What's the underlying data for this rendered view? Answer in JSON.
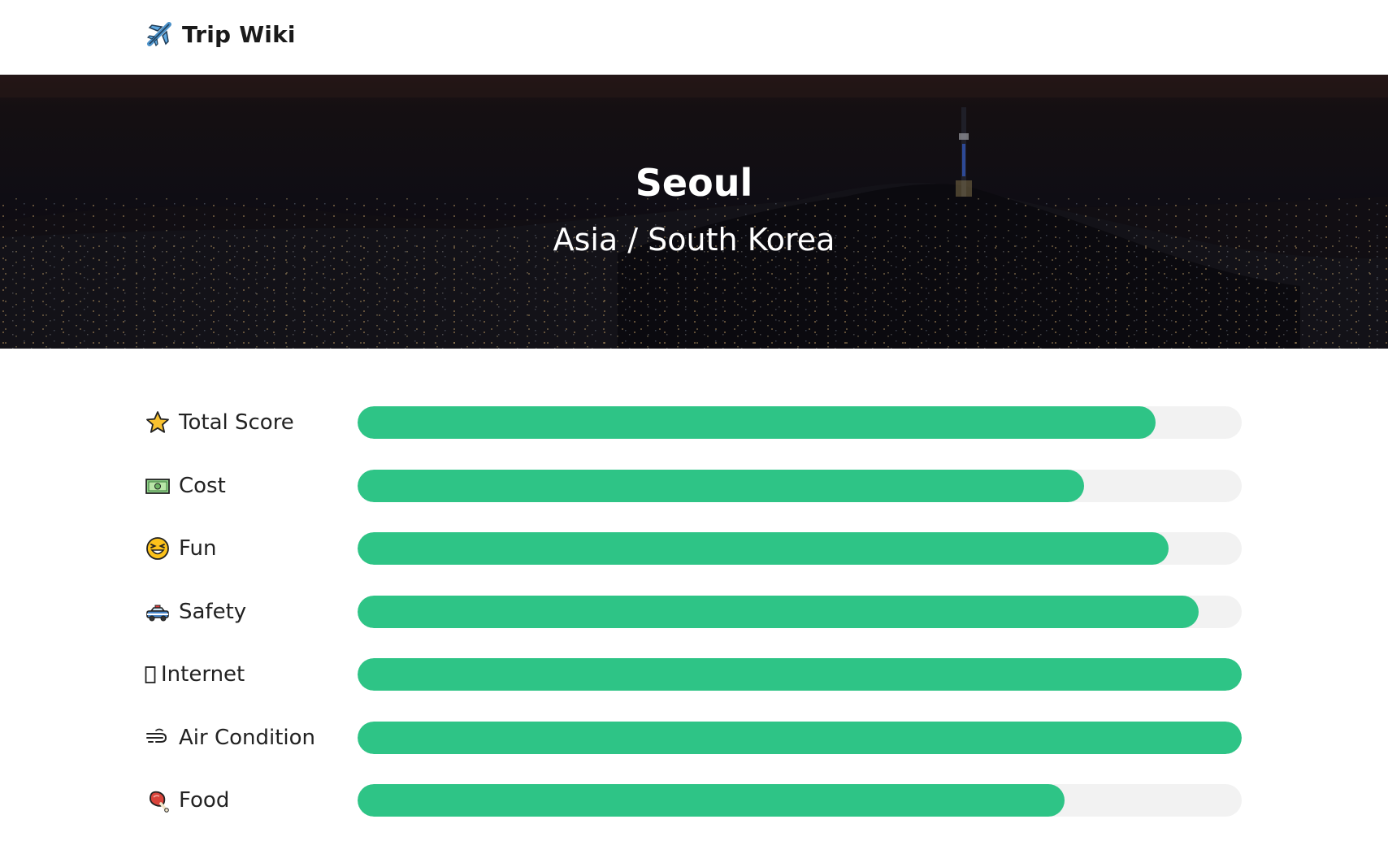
{
  "app": {
    "name": "Trip Wiki",
    "logo_icon": "airplane-icon"
  },
  "city": {
    "name": "Seoul",
    "location": "Asia / South Korea"
  },
  "colors": {
    "bar_fill": "#2ec486",
    "bar_track": "#f2f2f2"
  },
  "scores": [
    {
      "label": "Total Score",
      "icon": "star-icon",
      "value": 0.903
    },
    {
      "label": "Cost",
      "icon": "money-icon",
      "value": 0.822
    },
    {
      "label": "Fun",
      "icon": "laughing-face-icon",
      "value": 0.917
    },
    {
      "label": "Safety",
      "icon": "police-car-icon",
      "value": 0.951
    },
    {
      "label": "Internet",
      "icon": "missing-glyph-icon",
      "value": 1.0
    },
    {
      "label": "Air Condition",
      "icon": "wind-icon",
      "value": 1.0
    },
    {
      "label": "Food",
      "icon": "meat-icon",
      "value": 0.8
    }
  ]
}
